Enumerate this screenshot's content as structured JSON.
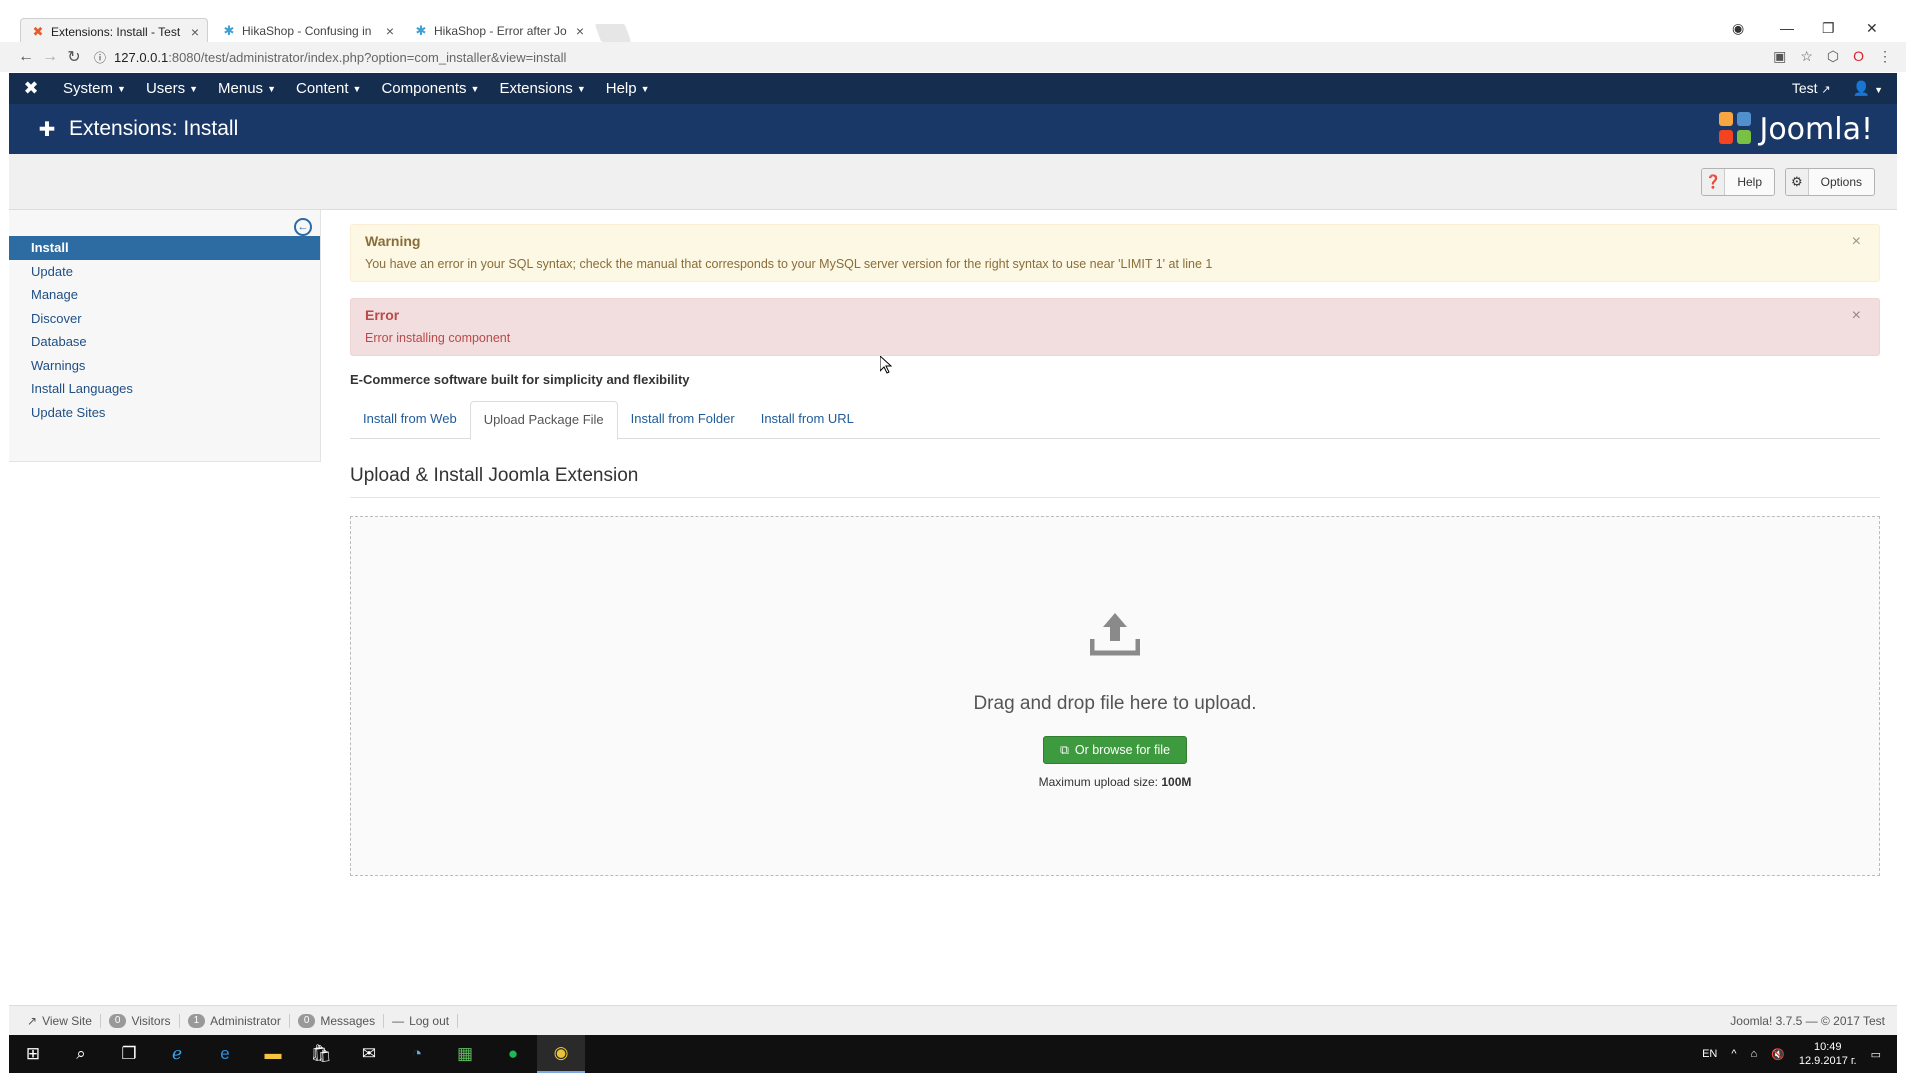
{
  "browser": {
    "tabs": [
      {
        "title": "Extensions: Install - Test",
        "icon": "joomla-icon"
      },
      {
        "title": "HikaShop - Confusing in",
        "icon": "hikashop-icon"
      },
      {
        "title": "HikaShop - Error after Jo",
        "icon": "hikashop-icon"
      }
    ],
    "url_host": "127.0.0.1",
    "url_rest": ":8080/test/administrator/index.php?option=com_installer&view=install"
  },
  "topnav": {
    "menus": [
      "System",
      "Users",
      "Menus",
      "Content",
      "Components",
      "Extensions",
      "Help"
    ],
    "site_link": "Test"
  },
  "header": {
    "title": "Extensions: Install",
    "brand": "Joomla!"
  },
  "toolbar": {
    "help_label": "Help",
    "options_label": "Options"
  },
  "sidebar": {
    "items": [
      "Install",
      "Update",
      "Manage",
      "Discover",
      "Database",
      "Warnings",
      "Install Languages",
      "Update Sites"
    ]
  },
  "alerts": {
    "warning_title": "Warning",
    "warning_text": "You have an error in your SQL syntax; check the manual that corresponds to your MySQL server version for the right syntax to use near 'LIMIT 1' at line 1",
    "error_title": "Error",
    "error_text": "Error installing component"
  },
  "main": {
    "description": "E-Commerce software built for simplicity and flexibility",
    "tabs": [
      "Install from Web",
      "Upload Package File",
      "Install from Folder",
      "Install from URL"
    ],
    "section_title": "Upload & Install Joomla Extension",
    "dropzone_text": "Drag and drop file here to upload.",
    "browse_label": "Or browse for file",
    "max_upload_label": "Maximum upload size:",
    "max_upload_value": "100M"
  },
  "status": {
    "view_site": "View Site",
    "visitors_count": "0",
    "visitors_label": "Visitors",
    "admin_count": "1",
    "admin_label": "Administrator",
    "messages_count": "0",
    "messages_label": "Messages",
    "logout": "Log out",
    "version": "Joomla! 3.7.5 — © 2017 Test"
  },
  "taskbar": {
    "lang": "EN",
    "time": "10:49",
    "date": "12.9.2017 г."
  }
}
